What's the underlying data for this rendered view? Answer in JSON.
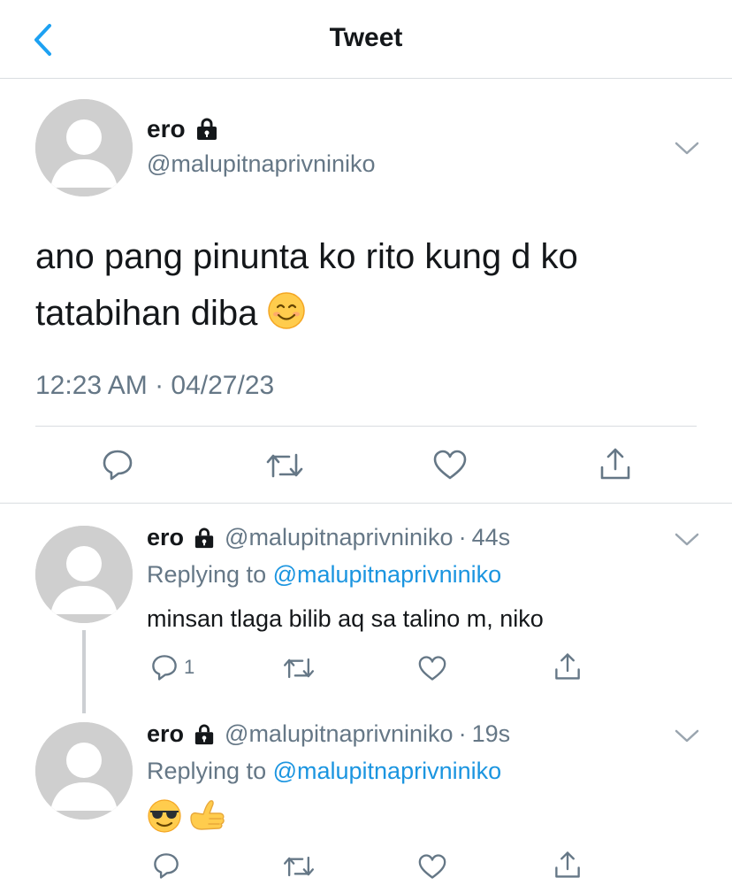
{
  "nav": {
    "title": "Tweet",
    "back_icon": "chevron-left-icon"
  },
  "colors": {
    "link": "#1b95e0",
    "back": "#1da1f2",
    "secondary": "#657786",
    "icon": "#657786",
    "avatar_bg": "#cfcfcf"
  },
  "main_tweet": {
    "name": "ero",
    "handle": "@malupitnaprivniniko",
    "text": "ano pang pinunta ko rito kung d ko tatabihan diba",
    "text_emoji": "smiling-face-icon",
    "timestamp": "12:23 AM · 04/27/23",
    "actions": [
      "reply-icon",
      "retweet-icon",
      "like-icon",
      "share-icon"
    ]
  },
  "replies": [
    {
      "name": "ero",
      "handle": "@malupitnaprivniniko",
      "dot": "·",
      "time": "44s",
      "replying_prefix": "Replying to ",
      "replying_to": "@malupitnaprivniniko",
      "text": "minsan tlaga bilib aq sa talino m, niko",
      "reply_count": "1"
    },
    {
      "name": "ero",
      "handle": "@malupitnaprivniniko",
      "dot": "·",
      "time": "19s",
      "replying_prefix": "Replying to ",
      "replying_to": "@malupitnaprivniniko",
      "emojis": [
        "sunglasses-face-icon",
        "call-me-hand-icon"
      ],
      "reply_count": ""
    }
  ]
}
